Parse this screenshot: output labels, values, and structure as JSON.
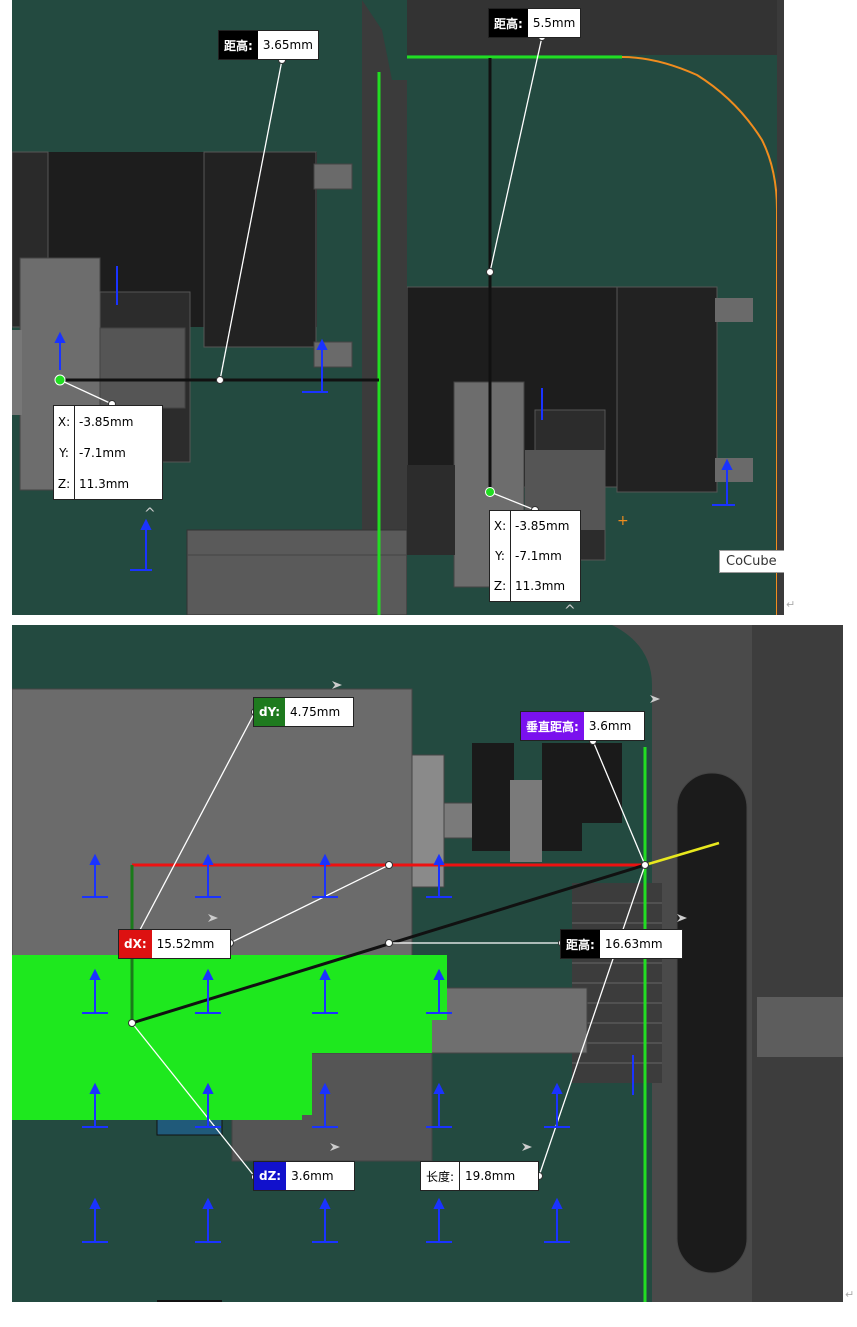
{
  "panel_top_left": {
    "distance": {
      "label": "距高:",
      "value": "3.65mm"
    },
    "coords": [
      {
        "axis": "X:",
        "value": "-3.85mm"
      },
      {
        "axis": "Y:",
        "value": "-7.1mm"
      },
      {
        "axis": "Z:",
        "value": "11.3mm"
      }
    ]
  },
  "panel_top_right": {
    "distance": {
      "label": "距高:",
      "value": "5.5mm"
    },
    "coords": [
      {
        "axis": "X:",
        "value": "-3.85mm"
      },
      {
        "axis": "Y:",
        "value": "-7.1mm"
      },
      {
        "axis": "Z:",
        "value": "11.3mm"
      }
    ],
    "tooltip": "CoCube"
  },
  "panel_bottom": {
    "dy": {
      "label": "dY:",
      "value": "4.75mm"
    },
    "dx": {
      "label": "dX:",
      "value": "15.52mm"
    },
    "dz": {
      "label": "dZ:",
      "value": "3.6mm"
    },
    "vertical": {
      "label": "垂直距高:",
      "value": "3.6mm"
    },
    "distance": {
      "label": "距高:",
      "value": "16.63mm"
    },
    "length": {
      "label": "长度:",
      "value": "19.8mm"
    }
  },
  "colors": {
    "background": "#234a40",
    "green_line": "#22dd22",
    "red_line": "#ee1111",
    "orange_edge": "#f08c1e",
    "dy_label": "#1e7a1e",
    "dx_label": "#dd1111",
    "dz_label": "#1111cc",
    "vertical_label": "#7a11ee",
    "distance_label": "#000000"
  },
  "return_mark": "↵"
}
